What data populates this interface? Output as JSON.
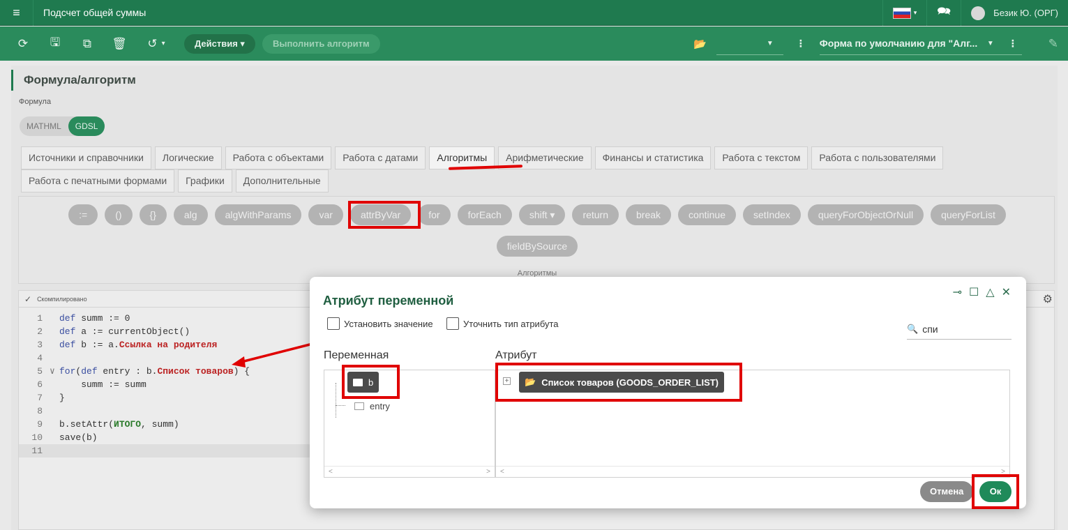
{
  "topbar": {
    "title": "Подсчет общей суммы",
    "user": "Безик Ю. (ОРГ)"
  },
  "toolbar": {
    "actions_label": "Действия ▾",
    "run_label": "Выполнить алгоритм",
    "form_label": "Форма по умолчанию для \"Алг..."
  },
  "main": {
    "section_title": "Формула/алгоритм",
    "formula_label": "Формула",
    "toggle": [
      "MATHML",
      "GDSL"
    ],
    "tabs_row1": [
      "Источники и справочники",
      "Логические",
      "Работа с объектами",
      "Работа с датами",
      "Алгоритмы",
      "Арифметические",
      "Финансы и статистика",
      "Работа с текстом",
      "Работа с пользователями"
    ],
    "tabs_row2": [
      "Работа с печатными формами",
      "Графики",
      "Дополнительные"
    ],
    "functions_row1": [
      ":=",
      "()",
      "{}",
      "alg",
      "algWithParams",
      "var",
      "attrByVar",
      "for",
      "forEach",
      "shift ▾",
      "return",
      "break",
      "continue",
      "setIndex",
      "queryForObjectOrNull",
      "queryForList"
    ],
    "functions_row2": [
      "fieldBySource"
    ],
    "functions_caption": "Алгоритмы",
    "editor_status": "Скомпилировано"
  },
  "code": [
    {
      "n": "1",
      "parts": [
        [
          "kw",
          "def"
        ],
        [
          "t",
          " summ := 0"
        ]
      ]
    },
    {
      "n": "2",
      "parts": [
        [
          "kw",
          "def"
        ],
        [
          "t",
          " a := currentObject()"
        ]
      ]
    },
    {
      "n": "3",
      "parts": [
        [
          "kw",
          "def"
        ],
        [
          "t",
          " b := a."
        ],
        [
          "red",
          "Ссылка на родителя"
        ]
      ]
    },
    {
      "n": "4",
      "parts": []
    },
    {
      "n": "5",
      "parts": [
        [
          "kw",
          "for"
        ],
        [
          "t",
          "("
        ],
        [
          "kw",
          "def"
        ],
        [
          "t",
          " entry : b."
        ],
        [
          "red",
          "Список товаров"
        ],
        [
          "t",
          ") {"
        ]
      ]
    },
    {
      "n": "6",
      "parts": [
        [
          "t",
          "    summ := summ"
        ]
      ]
    },
    {
      "n": "7",
      "parts": [
        [
          "t",
          "}"
        ]
      ]
    },
    {
      "n": "8",
      "parts": []
    },
    {
      "n": "9",
      "parts": [
        [
          "t",
          "b.setAttr("
        ],
        [
          "grn",
          "ИТОГО"
        ],
        [
          "t",
          ", summ)"
        ]
      ]
    },
    {
      "n": "10",
      "parts": [
        [
          "t",
          "save(b)"
        ]
      ]
    },
    {
      "n": "11",
      "parts": []
    }
  ],
  "dialog": {
    "title": "Атрибут переменной",
    "check_set_value": "Установить значение",
    "check_refine_type": "Уточнить тип атрибута",
    "search_value": "спи",
    "var_column": "Переменная",
    "attr_column": "Атрибут",
    "variables": [
      "b",
      "entry"
    ],
    "attribute": "Список товаров (GOODS_ORDER_LIST)",
    "cancel_label": "Отмена",
    "ok_label": "Ок"
  },
  "colors": {
    "accent": "#1f7a4f",
    "annotation": "#e00000"
  }
}
